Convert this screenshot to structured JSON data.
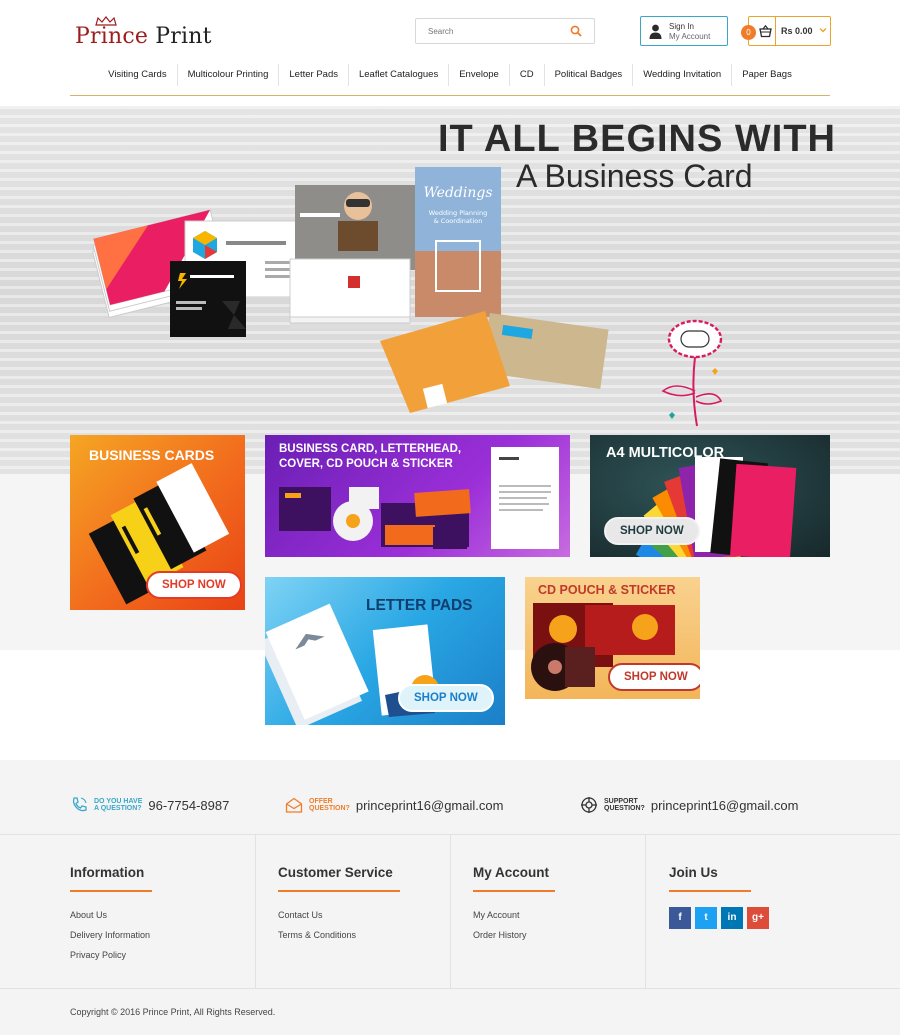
{
  "brand": {
    "name_part1": "Prince",
    "name_part2": "Print",
    "brand_color": "#9b1d1d"
  },
  "search": {
    "placeholder": "Search",
    "icon": "search-icon"
  },
  "account": {
    "line1": "Sign In",
    "line2": "My Account"
  },
  "cart": {
    "count": "0",
    "total": "Rs 0.00"
  },
  "nav": {
    "items": [
      "Visiting Cards",
      "Multicolour Printing",
      "Letter Pads",
      "Leaflet Catalogues",
      "Envelope",
      "CD",
      "Political Badges",
      "Wedding Invitation",
      "Paper Bags"
    ]
  },
  "hero": {
    "title": "IT ALL BEGINS WITH",
    "subtitle": "A Business Card"
  },
  "banners": {
    "business_cards": {
      "title": "BUSINESS CARDS",
      "cta": "SHOP NOW"
    },
    "combo": {
      "line1": "BUSINESS CARD, LETTERHEAD,",
      "line2": "COVER, CD POUCH & STICKER"
    },
    "a4": {
      "title": "A4 MULTICOLOR",
      "cta": "SHOP NOW"
    },
    "letter_pads": {
      "title": "LETTER PADS",
      "cta": "SHOP NOW"
    },
    "cd_pouch": {
      "title": "CD POUCH & STICKER",
      "cta": "SHOP NOW"
    }
  },
  "contact": {
    "phone_label_1": "DO YOU HAVE",
    "phone_label_2": "A QUESTION?",
    "phone": "96-7754-8987",
    "offer_label_1": "OFFER",
    "offer_label_2": "QUESTION?",
    "offer_email": "princeprint16@gmail.com",
    "support_label_1": "SUPPORT",
    "support_label_2": "QUESTION?",
    "support_email": "princeprint16@gmail.com"
  },
  "footer": {
    "information": {
      "title": "Information",
      "links": [
        "About Us",
        "Delivery Information",
        "Privacy Policy"
      ]
    },
    "customer_service": {
      "title": "Customer Service",
      "links": [
        "Contact Us",
        "Terms & Conditions"
      ]
    },
    "my_account": {
      "title": "My Account",
      "links": [
        "My Account",
        "Order History"
      ]
    },
    "join_us": {
      "title": "Join Us",
      "social": [
        {
          "glyph": "f",
          "icon": "facebook-icon",
          "color": "#3b5998"
        },
        {
          "glyph": "t",
          "icon": "twitter-icon",
          "color": "#1da1f2"
        },
        {
          "glyph": "in",
          "icon": "linkedin-icon",
          "color": "#0077b5"
        },
        {
          "glyph": "g+",
          "icon": "google-plus-icon",
          "color": "#dd4b39"
        }
      ]
    },
    "copyright": "Copyright © 2016 Prince Print, All Rights Reserved."
  },
  "colors": {
    "accent": "#f07c2a",
    "account_border": "#3aa7c9",
    "cart_border": "#e8a52e",
    "nav_rule": "#d6b26a"
  }
}
